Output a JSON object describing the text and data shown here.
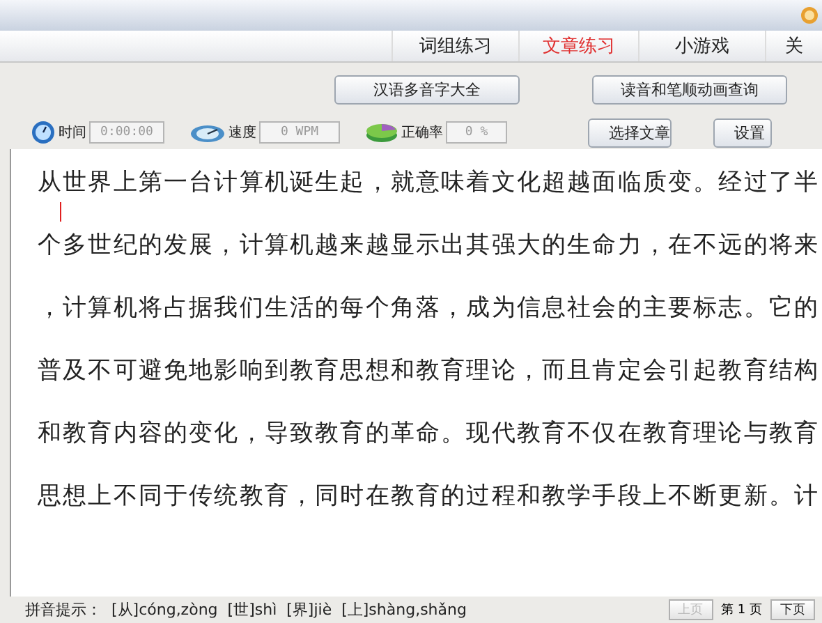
{
  "tabs": [
    {
      "label": "词组练习",
      "selected": false
    },
    {
      "label": "文章练习",
      "selected": true
    },
    {
      "label": "小游戏",
      "selected": false
    },
    {
      "label": "关",
      "selected": false
    }
  ],
  "tools": [
    "汉语多音字大全",
    "读音和笔顺动画查询"
  ],
  "stats": [
    {
      "kind": "time",
      "label": "时间",
      "value": "0:00:00"
    },
    {
      "kind": "speed",
      "label": "速度",
      "value": "0 WPM"
    },
    {
      "kind": "accuracy",
      "label": "正确率",
      "value": "0 %"
    }
  ],
  "actions": [
    "选择文章",
    "设置"
  ],
  "article_lines": [
    "从世界上第一台计算机诞生起，就意味着文化超越面临质变。经过了半",
    "个多世纪的发展，计算机越来越显示出其强大的生命力，在不远的将来",
    "，计算机将占据我们生活的每个角落，成为信息社会的主要标志。它的",
    "普及不可避免地影响到教育思想和教育理论，而且肯定会引起教育结构",
    "和教育内容的变化，导致教育的革命。现代教育不仅在教育理论与教育",
    "思想上不同于传统教育，同时在教育的过程和教学手段上不断更新。计"
  ],
  "status_bar": {
    "hint_label": "拼音提示：",
    "hints": [
      "[从]cóng,zòng",
      "[世]shì",
      "[界]jiè",
      "[上]shàng,shǎng"
    ],
    "prev": {
      "label": "上页",
      "disabled": true
    },
    "page": "第 1 页",
    "next": {
      "label": "下页",
      "disabled": false
    }
  }
}
